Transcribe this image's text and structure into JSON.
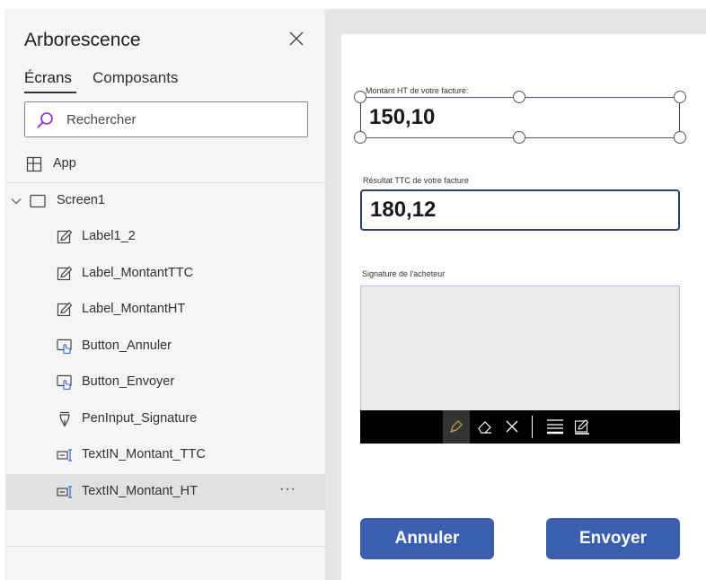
{
  "tree_panel": {
    "title": "Arborescence",
    "tabs": [
      {
        "label": "Écrans",
        "active": true
      },
      {
        "label": "Composants",
        "active": false
      }
    ],
    "search": {
      "placeholder": "Rechercher",
      "value": ""
    },
    "items": [
      {
        "label": "App",
        "icon": "app-grid-icon"
      },
      {
        "label": "Screen1",
        "icon": "screen-icon",
        "expanded": true
      },
      {
        "label": "Label1_2",
        "icon": "label-edit-icon"
      },
      {
        "label": "Label_MontantTTC",
        "icon": "label-edit-icon"
      },
      {
        "label": "Label_MontantHT",
        "icon": "label-edit-icon"
      },
      {
        "label": "Button_Annuler",
        "icon": "button-click-icon"
      },
      {
        "label": "Button_Envoyer",
        "icon": "button-click-icon"
      },
      {
        "label": "PenInput_Signature",
        "icon": "pen-nib-icon"
      },
      {
        "label": "TextIN_Montant_TTC",
        "icon": "text-input-icon"
      },
      {
        "label": "TextIN_Montant_HT",
        "icon": "text-input-icon",
        "selected": true
      }
    ],
    "more_label": "···"
  },
  "app_screen": {
    "field_ht": {
      "label": "Montant HT de votre facture:",
      "value": "150,10"
    },
    "field_ttc": {
      "label": "Résultat TTC de votre facture",
      "value": "180,12"
    },
    "signature": {
      "label": "Signature de l'acheteur"
    },
    "buttons": {
      "cancel": "Annuler",
      "send": "Envoyer"
    }
  },
  "colors": {
    "panel_bg": "#f5f5f5",
    "selected_row": "#e1e1e1",
    "button_primary": "#3a5fae",
    "search_icon": "#8a2be2",
    "canvas_bg": "#e6e6e6"
  }
}
